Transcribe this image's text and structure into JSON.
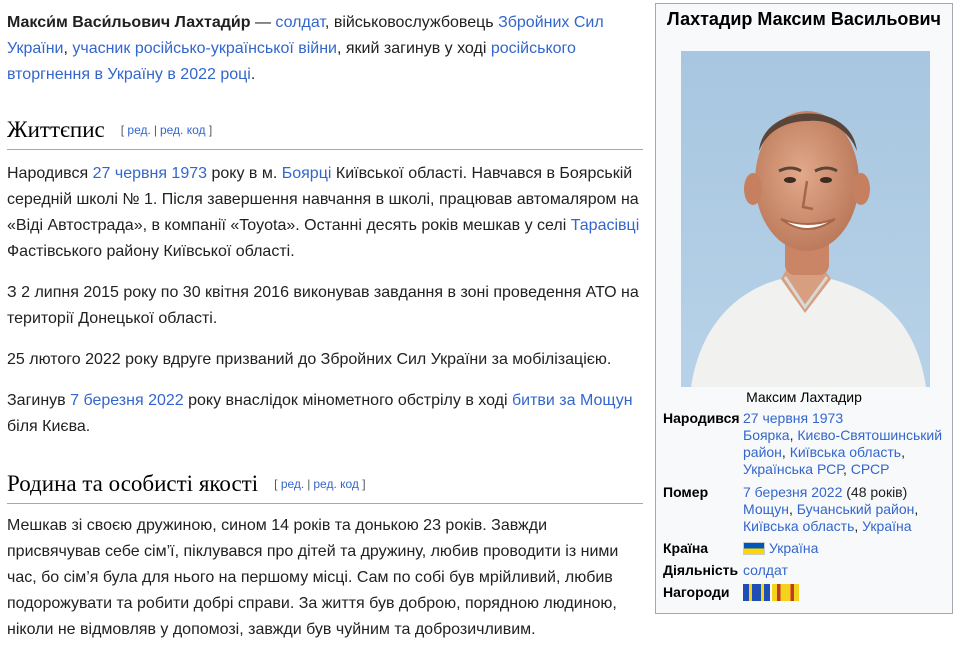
{
  "article": {
    "lead": {
      "name": "Макси́м Васи́льович Лахтади́р",
      "dash": " — ",
      "soldier": "солдат",
      "t1": ", військовослужбовець ",
      "zsu": "Збройних Сил України",
      "t2": ", ",
      "war": "учасник російсько-української війни",
      "t3": ", який загинув у ході ",
      "invasion": "російського вторгнення в Україну в 2022 році",
      "t4": "."
    },
    "section1": {
      "heading": "Життєпис",
      "edit": "ред.",
      "edit_code": "ред. код",
      "p1": {
        "a": "Народився ",
        "date": "27 червня 1973",
        "b": " року в м. ",
        "city": "Боярці",
        "c": " Київської області. Навчався в Боярській середній школі № 1. Після завершення навчання в школі, працював автомаляром на «Віді Автострада», в компанії «Toyota». Останні десять років мешкав у селі ",
        "village": "Тарасівці",
        "d": " Фастівського району Київської області."
      },
      "p2": "З 2 липня 2015 року по 30 квітня 2016 виконував завдання в зоні проведення АТО на території Донецької області.",
      "p3": "25 лютого 2022 року вдруге призваний до Збройних Сил України за мобілізацією.",
      "p4": {
        "a": "Загинув ",
        "date": "7 березня 2022",
        "b": " року внаслідок мінометного обстрілу в ході ",
        "battle": "битви за Мощун",
        "c": " біля Києва."
      }
    },
    "section2": {
      "heading": "Родина та особисті якості",
      "edit": "ред.",
      "edit_code": "ред. код",
      "p1": "Мешкав зі своєю дружиною, сином 14 років та донькою 23 років. Завжди присвячував себе сім’ї, піклувався про дітей та дружину, любив проводити із ними час, бо сім’я була для нього на першому місці. Сам по собі був мрійливий, любив подорожувати та робити добрі справи. За життя був доброю, порядною людиною, ніколи не відмовляв у допомозі, завжди був чуйним та доброзичливим."
    }
  },
  "infobox": {
    "title": "Лахтадир Максим Васильович",
    "caption": "Максим Лахтадир",
    "born": {
      "label": "Народився",
      "date": "27 червня 1973",
      "city": "Боярка",
      "c1": ", ",
      "district": "Києво-Святошинський район",
      "c2": ", ",
      "oblast": "Київська область",
      "c3": ", ",
      "ssr": "Українська РСР",
      "c4": ", ",
      "ussr": "СРСР"
    },
    "died": {
      "label": "Помер",
      "date": "7 березня 2022",
      "age": " (48 років)",
      "place": "Мощун",
      "c1": ", ",
      "district": "Бучанський район",
      "c2": ", ",
      "oblast": "Київська область",
      "c3": ", ",
      "country": "Україна"
    },
    "country": {
      "label": "Країна",
      "value": "Україна"
    },
    "activity": {
      "label": "Діяльність",
      "value": "солдат"
    },
    "awards": {
      "label": "Нагороди"
    }
  },
  "colors": {
    "link": "#3366cc",
    "text": "#202122",
    "infobox_bg": "#f8f9fa",
    "border": "#a2a9b1"
  }
}
